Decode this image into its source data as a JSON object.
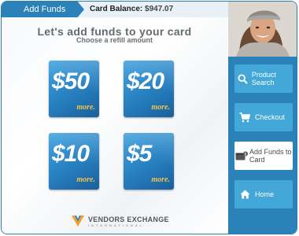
{
  "header": {
    "tab_label": "Add Funds",
    "balance_label": "Card Balance:",
    "balance_value": "$947.07"
  },
  "main": {
    "title": "Let's add funds to your card",
    "subtitle": "Choose a refill amount",
    "cards": [
      {
        "amount": "$50",
        "tag": "more."
      },
      {
        "amount": "$20",
        "tag": "more."
      },
      {
        "amount": "$10",
        "tag": "more."
      },
      {
        "amount": "$5",
        "tag": "more."
      }
    ]
  },
  "logo": {
    "name": "VENDORS EXCHANGE",
    "sub": "INTERNATIONAL"
  },
  "sidebar": {
    "items": [
      {
        "label": "Product Search",
        "icon": "search-icon"
      },
      {
        "label": "Checkout",
        "icon": "cart-icon"
      },
      {
        "label": "Add Funds to Card",
        "icon": "wallet-icon",
        "active": true
      },
      {
        "label": "Home",
        "icon": "home-icon"
      }
    ]
  },
  "colors": {
    "primary": "#2b82b8",
    "button": "#43a8d8",
    "card_accent": "#f2c44b"
  }
}
